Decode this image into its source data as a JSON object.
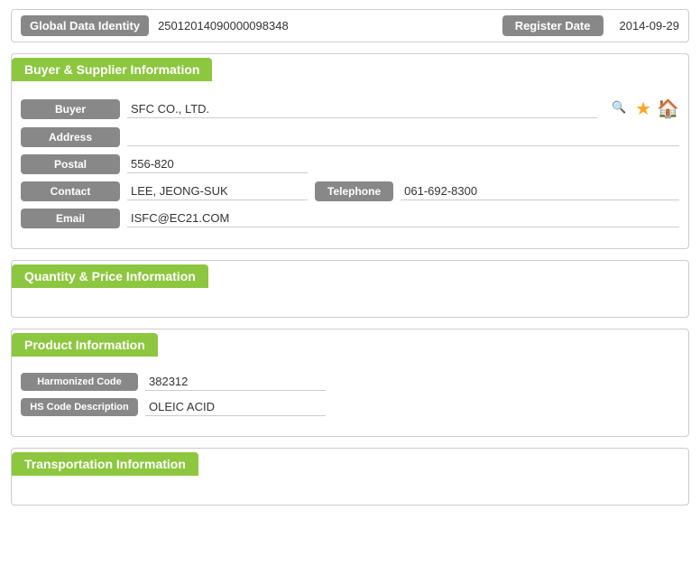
{
  "globalBar": {
    "label": "Global Data Identity",
    "value": "25012014090000098348",
    "registerDateLabel": "Register Date",
    "registerDateValue": "2014-09-29"
  },
  "buyerSupplierSection": {
    "title": "Buyer & Supplier Information",
    "fields": {
      "buyerLabel": "Buyer",
      "buyerValue": "SFC CO., LTD.",
      "addressLabel": "Address",
      "addressValue": "",
      "postalLabel": "Postal",
      "postalValue": "556-820",
      "contactLabel": "Contact",
      "contactValue": "LEE, JEONG-SUK",
      "telephoneLabel": "Telephone",
      "telephoneValue": "061-692-8300",
      "emailLabel": "Email",
      "emailValue": "ISFC@EC21.COM"
    }
  },
  "quantityPriceSection": {
    "title": "Quantity & Price Information"
  },
  "productSection": {
    "title": "Product Information",
    "fields": {
      "harmonizedCodeLabel": "Harmonized Code",
      "harmonizedCodeValue": "382312",
      "hsCodeDescLabel": "HS Code Description",
      "hsCodeDescValue": "OLEIC ACID"
    }
  },
  "transportationSection": {
    "title": "Transportation Information"
  },
  "icons": {
    "search": "🔍",
    "star": "★",
    "home": "🏠"
  }
}
